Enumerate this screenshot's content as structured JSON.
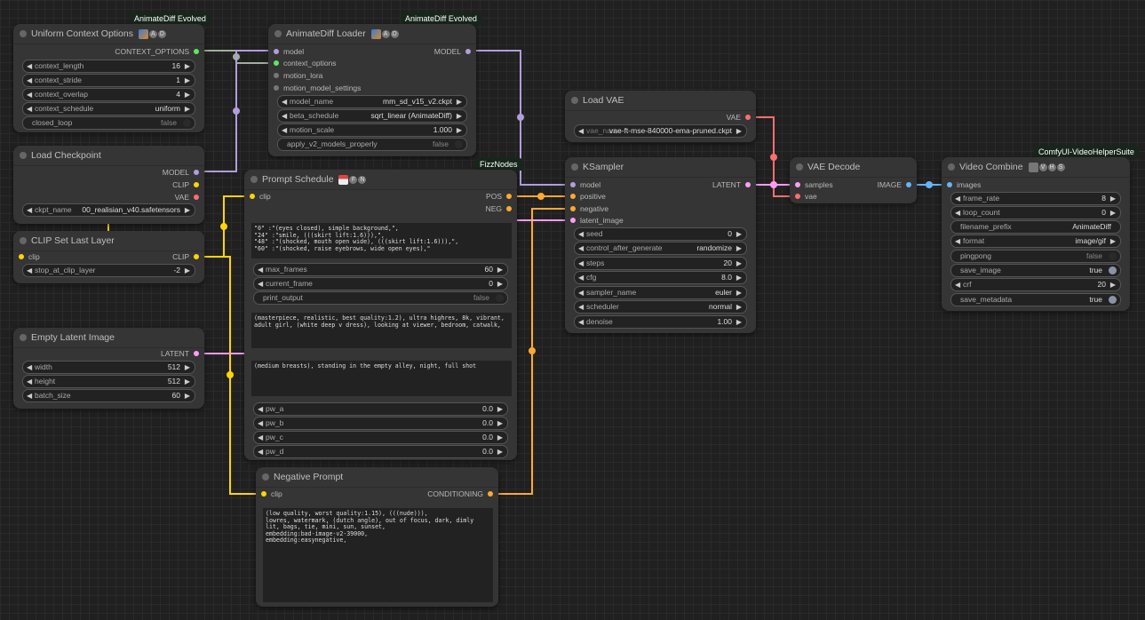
{
  "colors": {
    "model": "#b39ddb",
    "clip": "#ffd500",
    "vae": "#ff6e6e",
    "latent": "#ff9cf9",
    "conditioning": "#ffa931",
    "image": "#64b5f6",
    "context": "#5ee85e",
    "other": "#777777",
    "context_link": "#a0b09a"
  },
  "nodes": {
    "uniform_context": {
      "tag": "AnimateDiff Evolved",
      "title": "Uniform Context Options",
      "badge": [
        "A",
        "D"
      ],
      "outputs": [
        "CONTEXT_OPTIONS"
      ],
      "widgets": [
        {
          "name": "context_length",
          "value": "16"
        },
        {
          "name": "context_stride",
          "value": "1"
        },
        {
          "name": "context_overlap",
          "value": "4"
        },
        {
          "name": "context_schedule",
          "value": "uniform"
        },
        {
          "name": "closed_loop",
          "value": "false"
        }
      ]
    },
    "animatediff_loader": {
      "tag": "AnimateDiff Evolved",
      "title": "AnimateDiff Loader",
      "badge": [
        "A",
        "D"
      ],
      "inputs": [
        "model",
        "context_options",
        "motion_lora",
        "motion_model_settings"
      ],
      "outputs": [
        "MODEL"
      ],
      "widgets": [
        {
          "name": "model_name",
          "value": "mm_sd_v15_v2.ckpt"
        },
        {
          "name": "beta_schedule",
          "value": "sqrt_linear (AnimateDiff)"
        },
        {
          "name": "motion_scale",
          "value": "1.000"
        },
        {
          "name": "apply_v2_models_properly",
          "value": "false"
        }
      ]
    },
    "load_vae": {
      "title": "Load VAE",
      "outputs": [
        "VAE"
      ],
      "widgets": [
        {
          "name": "vae_name",
          "value": "vae-ft-mse-840000-ema-pruned.ckpt"
        }
      ]
    },
    "load_checkpoint": {
      "title": "Load Checkpoint",
      "outputs": [
        "MODEL",
        "CLIP",
        "VAE"
      ],
      "widgets": [
        {
          "name": "ckpt_name",
          "value": "00_realisian_v40.safetensors"
        }
      ]
    },
    "clip_set_last_layer": {
      "title": "CLIP Set Last Layer",
      "inputs": [
        "clip"
      ],
      "outputs": [
        "CLIP"
      ],
      "widgets": [
        {
          "name": "stop_at_clip_layer",
          "value": "-2"
        }
      ]
    },
    "prompt_schedule": {
      "tag": "FizzNodes",
      "title": "Prompt Schedule",
      "badge": [
        "F",
        "N"
      ],
      "inputs": [
        "clip"
      ],
      "outputs": [
        "POS",
        "NEG"
      ],
      "text": "\"0\" :\"(eyes closed), simple background,\",\n\"24\" :\"smile, (((skirt lift:1.6))),\",\n\"48\" :\"(shocked, mouth open wide), (((skirt lift:1.6))),\",\n\"60\" :\"(shocked, raise eyebrows, wide open eyes),\"",
      "widgets": [
        {
          "name": "max_frames",
          "value": "60"
        },
        {
          "name": "current_frame",
          "value": "0"
        },
        {
          "name": "print_output",
          "value": "false"
        }
      ],
      "pre_text": "(masterpiece, realistic, best quality:1.2), ultra highres, 8k, vibrant, adult girl, (white deep v dress), looking at viewer, bedroom, catwalk,",
      "app_text": "(medium breasts), standing in the empty alley, night, full shot",
      "pw": [
        {
          "name": "pw_a",
          "value": "0.0"
        },
        {
          "name": "pw_b",
          "value": "0.0"
        },
        {
          "name": "pw_c",
          "value": "0.0"
        },
        {
          "name": "pw_d",
          "value": "0.0"
        }
      ]
    },
    "ksampler": {
      "title": "KSampler",
      "inputs": [
        "model",
        "positive",
        "negative",
        "latent_image"
      ],
      "outputs": [
        "LATENT"
      ],
      "widgets": [
        {
          "name": "seed",
          "value": "0"
        },
        {
          "name": "control_after_generate",
          "value": "randomize"
        },
        {
          "name": "steps",
          "value": "20"
        },
        {
          "name": "cfg",
          "value": "8.0"
        },
        {
          "name": "sampler_name",
          "value": "euler"
        },
        {
          "name": "scheduler",
          "value": "normal"
        },
        {
          "name": "denoise",
          "value": "1.00"
        }
      ]
    },
    "vae_decode": {
      "title": "VAE Decode",
      "inputs": [
        "samples",
        "vae"
      ],
      "outputs": [
        "IMAGE"
      ]
    },
    "video_combine": {
      "tag": "ComfyUI-VideoHelperSuite",
      "title": "Video Combine",
      "badge": [
        "V",
        "H",
        "S"
      ],
      "inputs": [
        "images"
      ],
      "widgets": [
        {
          "name": "frame_rate",
          "value": "8"
        },
        {
          "name": "loop_count",
          "value": "0"
        },
        {
          "name": "filename_prefix",
          "value": "AnimateDiff"
        },
        {
          "name": "format",
          "value": "image/gif"
        },
        {
          "name": "pingpong",
          "value": "false"
        },
        {
          "name": "save_image",
          "value": "true"
        },
        {
          "name": "crf",
          "value": "20"
        },
        {
          "name": "save_metadata",
          "value": "true"
        }
      ]
    },
    "empty_latent": {
      "title": "Empty Latent Image",
      "outputs": [
        "LATENT"
      ],
      "widgets": [
        {
          "name": "width",
          "value": "512"
        },
        {
          "name": "height",
          "value": "512"
        },
        {
          "name": "batch_size",
          "value": "60"
        }
      ]
    },
    "negative_prompt": {
      "title": "Negative Prompt",
      "inputs": [
        "clip"
      ],
      "outputs": [
        "CONDITIONING"
      ],
      "text": "(low quality, worst quality:1.15), (((nude))),\nlowres, watermark, (dutch angle), out of focus, dark, dimly lit, bags, tie, mini, sun, sunset,\nembedding:bad-image-v2-39000,\nembedding:easynegative,"
    }
  }
}
